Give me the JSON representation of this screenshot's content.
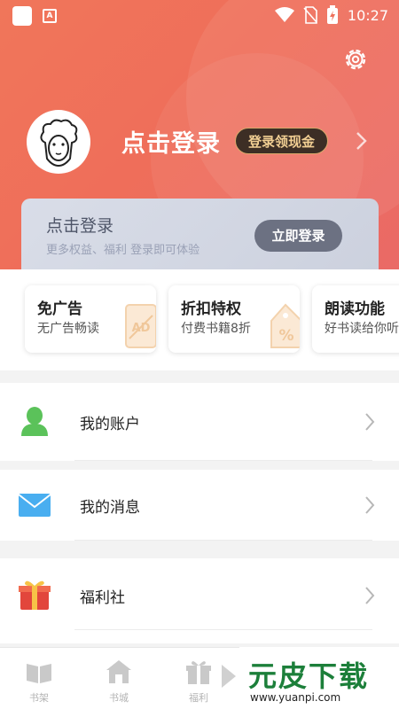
{
  "status_bar": {
    "time": "10:27"
  },
  "header": {
    "login_title": "点击登录",
    "login_badge": "登录领现金"
  },
  "login_card": {
    "title": "点击登录",
    "subtitle": "更多权益、福利 登录即可体验",
    "button": "立即登录"
  },
  "features": [
    {
      "title": "免广告",
      "subtitle": "无广告畅读",
      "icon": "no-ad-icon"
    },
    {
      "title": "折扣特权",
      "subtitle": "付费书籍8折",
      "icon": "discount-tag-icon"
    },
    {
      "title": "朗读功能",
      "subtitle": "好书读给你听",
      "icon": "read-aloud-icon"
    }
  ],
  "menu": [
    {
      "label": "我的账户",
      "icon": "account-icon"
    },
    {
      "label": "我的消息",
      "icon": "message-icon"
    },
    {
      "label": "福利社",
      "icon": "gift-icon"
    }
  ],
  "bottom_nav": [
    {
      "label": "书架",
      "icon": "bookshelf-icon"
    },
    {
      "label": "书城",
      "icon": "bookstore-icon"
    },
    {
      "label": "福利",
      "icon": "welfare-icon"
    }
  ],
  "watermark": {
    "main": "元皮下载",
    "url": "www.yuanpi.com"
  },
  "colors": {
    "header_bg": "#ef705a",
    "badge_bg": "#3d2e25",
    "badge_text": "#f2cf93",
    "card_bg": "#d5d9e4",
    "account_green": "#5bc25a",
    "message_blue": "#49aef0",
    "gift_red": "#e2463c"
  }
}
